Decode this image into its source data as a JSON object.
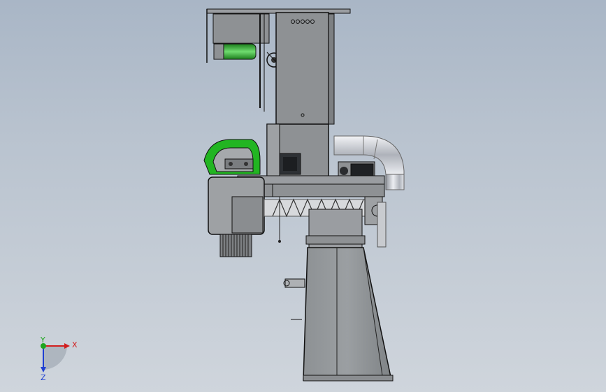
{
  "viewport": {
    "background_top": "#a9b6c6",
    "background_bottom": "#cfd5dc"
  },
  "triad": {
    "x_label": "X",
    "y_label": "Y",
    "z_label": "Z",
    "x_color": "#d21e1e",
    "y_color": "#1fa61f",
    "z_color": "#1f3fd2"
  },
  "model": {
    "primary_color": "#8e9194",
    "accent_green": "#22b522",
    "duct_color": "#c9ccd2"
  }
}
